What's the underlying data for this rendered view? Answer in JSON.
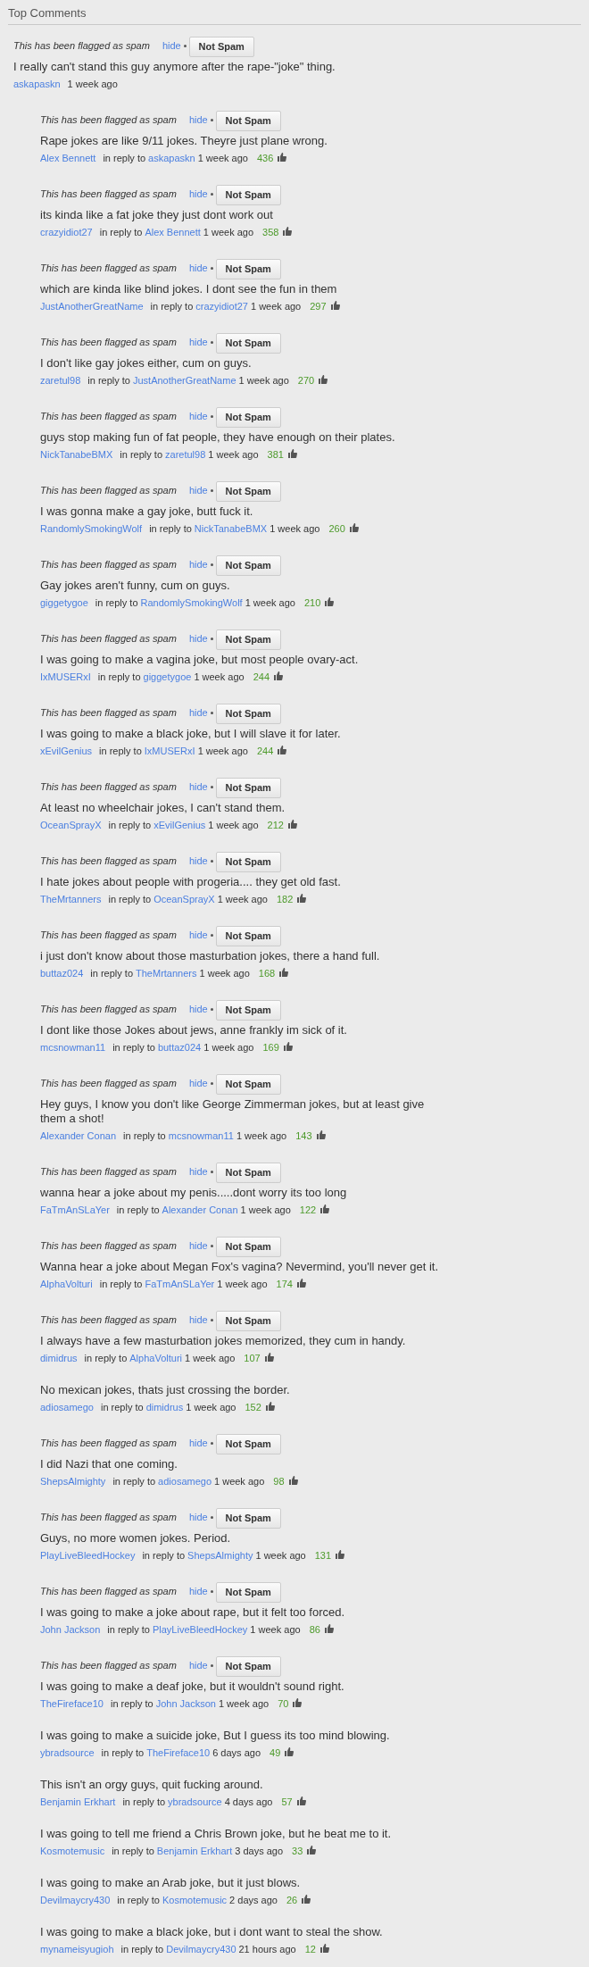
{
  "section_title": "Top Comments",
  "comments": [
    {
      "flagged": true,
      "flag_text": "This has been flagged as spam",
      "hide": "hide",
      "not_spam": "Not Spam",
      "text": "I really can't stand this guy anymore after the rape-\"joke\" thing.",
      "author": "askapaskn",
      "time": "1 week ago",
      "replies": [
        {
          "flagged": true,
          "flag_text": "This has been flagged as spam",
          "hide": "hide",
          "not_spam": "Not Spam",
          "text": "Rape jokes are like 9/11 jokes. Theyre just plane wrong.",
          "author": "Alex Bennett",
          "in_reply": "in reply to",
          "reply_to": "askapaskn",
          "time": "1 week ago",
          "likes": "436"
        },
        {
          "flagged": true,
          "flag_text": "This has been flagged as spam",
          "hide": "hide",
          "not_spam": "Not Spam",
          "text": "its kinda like a fat joke they just dont work out",
          "author": "crazyidiot27",
          "in_reply": "in reply to",
          "reply_to": "Alex Bennett",
          "time": "1 week ago",
          "likes": "358"
        },
        {
          "flagged": true,
          "flag_text": "This has been flagged as spam",
          "hide": "hide",
          "not_spam": "Not Spam",
          "text": "which are kinda like blind jokes. I dont see the fun in them",
          "author": "JustAnotherGreatName",
          "in_reply": "in reply to",
          "reply_to": "crazyidiot27",
          "time": "1 week ago",
          "likes": "297"
        },
        {
          "flagged": true,
          "flag_text": "This has been flagged as spam",
          "hide": "hide",
          "not_spam": "Not Spam",
          "text": "I don't like gay jokes either, cum on guys.",
          "author": "zaretul98",
          "in_reply": "in reply to",
          "reply_to": "JustAnotherGreatName",
          "time": "1 week ago",
          "likes": "270"
        },
        {
          "flagged": true,
          "flag_text": "This has been flagged as spam",
          "hide": "hide",
          "not_spam": "Not Spam",
          "text": "guys stop making fun of fat people, they have enough on their plates.",
          "author": "NickTanabeBMX",
          "in_reply": "in reply to",
          "reply_to": "zaretul98",
          "time": "1 week ago",
          "likes": "381"
        },
        {
          "flagged": true,
          "flag_text": "This has been flagged as spam",
          "hide": "hide",
          "not_spam": "Not Spam",
          "text": "I was gonna make a gay joke, butt fuck it.",
          "author": "RandomlySmokingWolf",
          "in_reply": "in reply to",
          "reply_to": "NickTanabeBMX",
          "time": "1 week ago",
          "likes": "260"
        },
        {
          "flagged": true,
          "flag_text": "This has been flagged as spam",
          "hide": "hide",
          "not_spam": "Not Spam",
          "text": "Gay jokes aren't funny, cum on guys.",
          "author": "giggetygoe",
          "in_reply": "in reply to",
          "reply_to": "RandomlySmokingWolf",
          "time": "1 week ago",
          "likes": "210"
        },
        {
          "flagged": true,
          "flag_text": "This has been flagged as spam",
          "hide": "hide",
          "not_spam": "Not Spam",
          "text": "I was going to make a vagina joke, but most people ovary-act.",
          "author": "IxMUSERxI",
          "in_reply": "in reply to",
          "reply_to": "giggetygoe",
          "time": "1 week ago",
          "likes": "244"
        },
        {
          "flagged": true,
          "flag_text": "This has been flagged as spam",
          "hide": "hide",
          "not_spam": "Not Spam",
          "text": "I was going to make a black joke, but I will slave it for later.",
          "author": "xEvilGenius",
          "in_reply": "in reply to",
          "reply_to": "IxMUSERxI",
          "time": "1 week ago",
          "likes": "244"
        },
        {
          "flagged": true,
          "flag_text": "This has been flagged as spam",
          "hide": "hide",
          "not_spam": "Not Spam",
          "text": "At least no wheelchair jokes, I can't stand them.",
          "author": "OceanSprayX",
          "in_reply": "in reply to",
          "reply_to": "xEvilGenius",
          "time": "1 week ago",
          "likes": "212"
        },
        {
          "flagged": true,
          "flag_text": "This has been flagged as spam",
          "hide": "hide",
          "not_spam": "Not Spam",
          "text": "I hate jokes about people with progeria.... they get old fast.",
          "author": "TheMrtanners",
          "in_reply": "in reply to",
          "reply_to": "OceanSprayX",
          "time": "1 week ago",
          "likes": "182"
        },
        {
          "flagged": true,
          "flag_text": "This has been flagged as spam",
          "hide": "hide",
          "not_spam": "Not Spam",
          "text": "i just don't know about those masturbation jokes, there a hand full.",
          "author": "buttaz024",
          "in_reply": "in reply to",
          "reply_to": "TheMrtanners",
          "time": "1 week ago",
          "likes": "168"
        },
        {
          "flagged": true,
          "flag_text": "This has been flagged as spam",
          "hide": "hide",
          "not_spam": "Not Spam",
          "text": "I dont like those Jokes about jews, anne frankly im sick of it.",
          "author": "mcsnowman11",
          "in_reply": "in reply to",
          "reply_to": "buttaz024",
          "time": "1 week ago",
          "likes": "169"
        },
        {
          "flagged": true,
          "flag_text": "This has been flagged as spam",
          "hide": "hide",
          "not_spam": "Not Spam",
          "text": "Hey guys, I know you don't like George Zimmerman jokes, but at least give them a shot!",
          "author": "Alexander Conan",
          "in_reply": "in reply to",
          "reply_to": "mcsnowman11",
          "time": "1 week ago",
          "likes": "143"
        },
        {
          "flagged": true,
          "flag_text": "This has been flagged as spam",
          "hide": "hide",
          "not_spam": "Not Spam",
          "text": "wanna hear a joke about my penis.....dont worry its too long",
          "author": "FaTmAnSLaYer",
          "in_reply": "in reply to",
          "reply_to": "Alexander Conan",
          "time": "1 week ago",
          "likes": "122"
        },
        {
          "flagged": true,
          "flag_text": "This has been flagged as spam",
          "hide": "hide",
          "not_spam": "Not Spam",
          "text": "Wanna hear a joke about Megan Fox's vagina? Nevermind, you'll never get it.",
          "author": "AlphaVolturi",
          "in_reply": "in reply to",
          "reply_to": "FaTmAnSLaYer",
          "time": "1 week ago",
          "likes": "174"
        },
        {
          "flagged": true,
          "flag_text": "This has been flagged as spam",
          "hide": "hide",
          "not_spam": "Not Spam",
          "text": "I always have a few masturbation jokes memorized, they cum in handy.",
          "author": "dimidrus",
          "in_reply": "in reply to",
          "reply_to": "AlphaVolturi",
          "time": "1 week ago",
          "likes": "107"
        },
        {
          "flagged": false,
          "text": "No mexican jokes, thats just crossing the border.",
          "author": "adiosamego",
          "in_reply": "in reply to",
          "reply_to": "dimidrus",
          "time": "1 week ago",
          "likes": "152"
        },
        {
          "flagged": true,
          "flag_text": "This has been flagged as spam",
          "hide": "hide",
          "not_spam": "Not Spam",
          "text": "I did Nazi that one coming.",
          "author": "ShepsAlmighty",
          "in_reply": "in reply to",
          "reply_to": "adiosamego",
          "time": "1 week ago",
          "likes": "98"
        },
        {
          "flagged": true,
          "flag_text": "This has been flagged as spam",
          "hide": "hide",
          "not_spam": "Not Spam",
          "text": "Guys, no more women jokes. Period.",
          "author": "PlayLiveBleedHockey",
          "in_reply": "in reply to",
          "reply_to": "ShepsAlmighty",
          "time": "1 week ago",
          "likes": "131"
        },
        {
          "flagged": true,
          "flag_text": "This has been flagged as spam",
          "hide": "hide",
          "not_spam": "Not Spam",
          "text": "I was going to make a joke about rape, but it felt too forced.",
          "author": "John Jackson",
          "in_reply": "in reply to",
          "reply_to": "PlayLiveBleedHockey",
          "time": "1 week ago",
          "likes": "86"
        },
        {
          "flagged": true,
          "flag_text": "This has been flagged as spam",
          "hide": "hide",
          "not_spam": "Not Spam",
          "text": "I was going to make a deaf joke, but it wouldn't sound right.",
          "author": "TheFireface10",
          "in_reply": "in reply to",
          "reply_to": "John Jackson",
          "time": "1 week ago",
          "likes": "70"
        },
        {
          "flagged": false,
          "text": "I was going to make a suicide joke, But I guess its too mind blowing.",
          "author": "ybradsource",
          "in_reply": "in reply to",
          "reply_to": "TheFireface10",
          "time": "6 days ago",
          "likes": "49"
        },
        {
          "flagged": false,
          "text": "This isn't an orgy guys, quit fucking around.",
          "author": "Benjamin Erkhart",
          "in_reply": "in reply to",
          "reply_to": "ybradsource",
          "time": "4 days ago",
          "likes": "57"
        },
        {
          "flagged": false,
          "text": "I was going to tell me friend a Chris Brown joke, but he beat me to it.",
          "author": "Kosmotemusic",
          "in_reply": "in reply to",
          "reply_to": "Benjamin Erkhart",
          "time": "3 days ago",
          "likes": "33"
        },
        {
          "flagged": false,
          "text": "I was going to make an Arab joke, but it just blows.",
          "author": "Devilmaycry430",
          "in_reply": "in reply to",
          "reply_to": "Kosmotemusic",
          "time": "2 days ago",
          "likes": "26"
        },
        {
          "flagged": false,
          "text": "I was going to make a black joke, but i dont want to steal the show.",
          "author": "mynameisyugioh",
          "in_reply": "in reply to",
          "reply_to": "Devilmaycry430",
          "time": "21 hours ago",
          "likes": "12"
        }
      ]
    }
  ]
}
